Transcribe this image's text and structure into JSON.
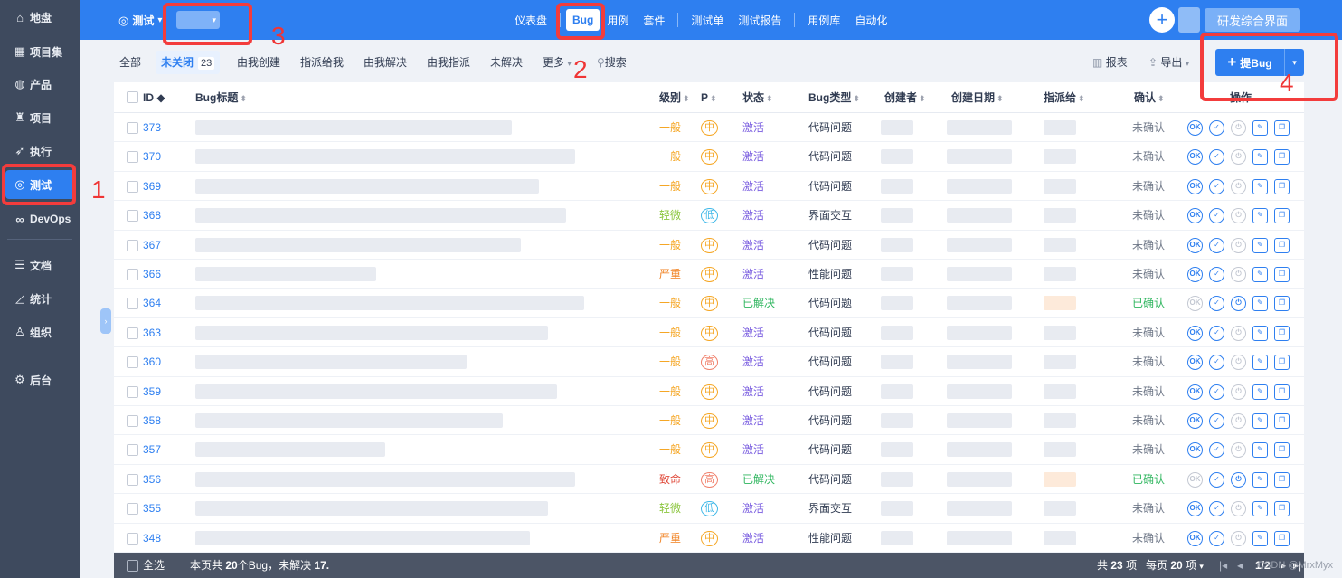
{
  "sidebar": {
    "items": [
      {
        "label": "地盘",
        "icon": "home-icon",
        "glyph": "⌂"
      },
      {
        "label": "项目集",
        "icon": "grid-icon",
        "glyph": "▦"
      },
      {
        "label": "产品",
        "icon": "product-icon",
        "glyph": "◍"
      },
      {
        "label": "项目",
        "icon": "project-icon",
        "glyph": "♜"
      },
      {
        "label": "执行",
        "icon": "run-icon",
        "glyph": "➶"
      },
      {
        "label": "测试",
        "icon": "test-icon",
        "glyph": "◎"
      },
      {
        "label": "DevOps",
        "icon": "devops-icon",
        "glyph": "∞"
      },
      {
        "label": "文档",
        "icon": "doc-icon",
        "glyph": "☰"
      },
      {
        "label": "统计",
        "icon": "chart-icon",
        "glyph": "◿"
      },
      {
        "label": "组织",
        "icon": "user-icon",
        "glyph": "♙"
      },
      {
        "label": "后台",
        "icon": "gear-icon",
        "glyph": "⚙"
      }
    ],
    "active_index": 5
  },
  "topbar": {
    "module_title": "测试",
    "nav": [
      "仪表盘",
      "Bug",
      "用例",
      "套件",
      "测试单",
      "测试报告",
      "用例库",
      "自动化"
    ],
    "active_nav": "Bug",
    "switch_button": "研发综合界面",
    "plus": "+"
  },
  "filters": {
    "all": "全部",
    "unclosed": "未关闭",
    "unclosed_count": "23",
    "created_by_me": "由我创建",
    "assigned_to_me": "指派给我",
    "resolved_by_me": "由我解决",
    "assigned_by_me": "由我指派",
    "unresolved": "未解决",
    "more": "更多",
    "search": "搜索",
    "report": "报表",
    "export": "导出",
    "new_bug": "提Bug"
  },
  "table": {
    "headers": {
      "id": "ID",
      "title": "Bug标题",
      "severity": "级别",
      "pri": "P",
      "status": "状态",
      "type": "Bug类型",
      "creator": "创建者",
      "date": "创建日期",
      "assigned": "指派给",
      "confirm": "确认",
      "actions": "操作"
    },
    "rows": [
      {
        "id": "373",
        "severity": "一般",
        "pri": "中",
        "status": "激活",
        "type": "代码问题",
        "confirm": "未确认"
      },
      {
        "id": "370",
        "severity": "一般",
        "pri": "中",
        "status": "激活",
        "type": "代码问题",
        "confirm": "未确认"
      },
      {
        "id": "369",
        "severity": "一般",
        "pri": "中",
        "status": "激活",
        "type": "代码问题",
        "confirm": "未确认"
      },
      {
        "id": "368",
        "severity": "轻微",
        "pri": "低",
        "status": "激活",
        "type": "界面交互",
        "confirm": "未确认"
      },
      {
        "id": "367",
        "severity": "一般",
        "pri": "中",
        "status": "激活",
        "type": "代码问题",
        "confirm": "未确认"
      },
      {
        "id": "366",
        "severity": "严重",
        "pri": "中",
        "status": "激活",
        "type": "性能问题",
        "confirm": "未确认"
      },
      {
        "id": "364",
        "severity": "一般",
        "pri": "中",
        "status": "已解决",
        "type": "代码问题",
        "confirm": "已确认"
      },
      {
        "id": "363",
        "severity": "一般",
        "pri": "中",
        "status": "激活",
        "type": "代码问题",
        "confirm": "未确认"
      },
      {
        "id": "360",
        "severity": "一般",
        "pri": "高",
        "status": "激活",
        "type": "代码问题",
        "confirm": "未确认"
      },
      {
        "id": "359",
        "severity": "一般",
        "pri": "中",
        "status": "激活",
        "type": "代码问题",
        "confirm": "未确认"
      },
      {
        "id": "358",
        "severity": "一般",
        "pri": "中",
        "status": "激活",
        "type": "代码问题",
        "confirm": "未确认"
      },
      {
        "id": "357",
        "severity": "一般",
        "pri": "中",
        "status": "激活",
        "type": "代码问题",
        "confirm": "未确认"
      },
      {
        "id": "356",
        "severity": "致命",
        "pri": "高",
        "status": "已解决",
        "type": "代码问题",
        "confirm": "已确认"
      },
      {
        "id": "355",
        "severity": "轻微",
        "pri": "低",
        "status": "激活",
        "type": "界面交互",
        "confirm": "未确认"
      },
      {
        "id": "348",
        "severity": "严重",
        "pri": "中",
        "status": "激活",
        "type": "性能问题",
        "confirm": "未确认"
      }
    ]
  },
  "footer": {
    "select_all": "全选",
    "summary_prefix": "本页共",
    "summary_count": "20",
    "summary_mid": "个Bug，未解决",
    "summary_unresolved": "17",
    "total_prefix": "共",
    "total_count": "23",
    "total_suffix": "项",
    "per_page_prefix": "每页",
    "per_page": "20",
    "per_page_suffix": "项",
    "page": "1/2"
  },
  "annotations": [
    "1",
    "2",
    "3",
    "4"
  ],
  "watermark": "CSDN @MrxMyx",
  "colors": {
    "accent": "#2e7ff0",
    "sidebar_bg": "#3e4a5e",
    "annotation_red": "#f33c3c",
    "sev_normal": "#f5a623",
    "sev_minor": "#8cc63f",
    "sev_serious": "#f07f1d",
    "sev_fatal": "#e04a3a",
    "status_active": "#7b5fe0",
    "status_resolved": "#2db55d"
  }
}
